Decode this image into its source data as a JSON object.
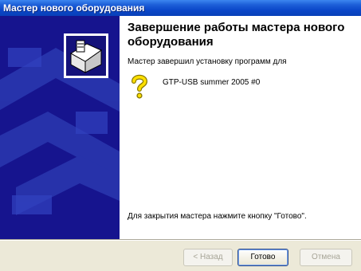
{
  "window": {
    "title": "Мастер нового оборудования"
  },
  "content": {
    "heading": "Завершение работы мастера нового оборудования",
    "intro": "Мастер завершил установку программ для",
    "device_name": "GTP-USB summer 2005 #0",
    "finish_hint": "Для закрытия мастера нажмите кнопку \"Готово\"."
  },
  "buttons": {
    "back": "< Назад",
    "finish": "Готово",
    "cancel": "Отмена"
  },
  "colors": {
    "title_bar": "#0a46c8",
    "left_panel": "#16148e",
    "dialog_bg": "#ece9d8"
  },
  "icons": {
    "wizard": "hardware-wizard-icon",
    "device": "question-mark-icon"
  }
}
